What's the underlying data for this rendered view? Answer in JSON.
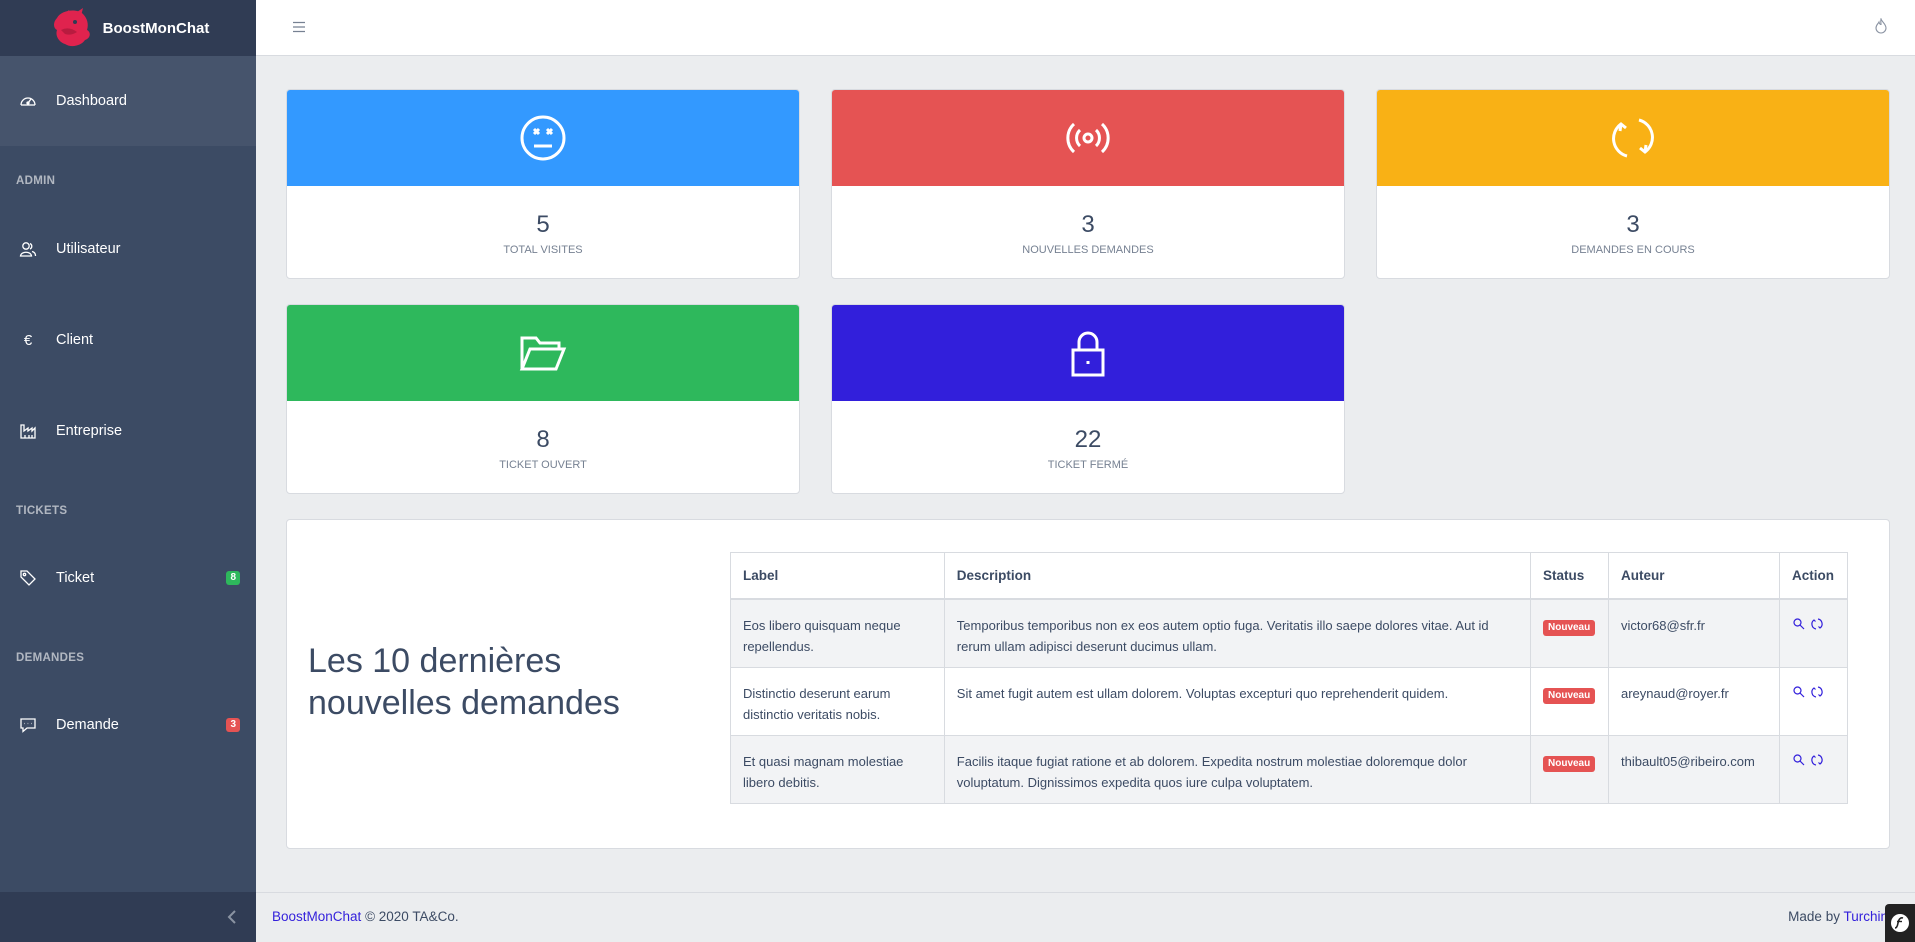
{
  "app": {
    "brand": "BoostMonChat"
  },
  "sidebar": {
    "items": [
      {
        "label": "Dashboard",
        "icon": "speedometer-icon"
      },
      {
        "title": "ADMIN"
      },
      {
        "label": "Utilisateur",
        "icon": "people-icon"
      },
      {
        "label": "Client",
        "icon": "euro-icon"
      },
      {
        "label": "Entreprise",
        "icon": "industry-icon"
      },
      {
        "title": "TICKETS"
      },
      {
        "label": "Ticket",
        "icon": "tags-icon",
        "badge": "8",
        "badge_color": "#2eb85c"
      },
      {
        "title": "DEMANDES"
      },
      {
        "label": "Demande",
        "icon": "comment-icon",
        "badge": "3",
        "badge_color": "#e55353"
      }
    ]
  },
  "widgets": [
    {
      "value": "5",
      "label": "TOTAL VISITES",
      "color": "#3399ff",
      "icon": "face-dead-icon"
    },
    {
      "value": "3",
      "label": "NOUVELLES DEMANDES",
      "color": "#e55353",
      "icon": "broadcast-icon"
    },
    {
      "value": "3",
      "label": "DEMANDES EN COURS",
      "color": "#f9b115",
      "icon": "sync-icon"
    },
    {
      "value": "8",
      "label": "TICKET OUVERT",
      "color": "#2eb85c",
      "icon": "folder-open-icon"
    },
    {
      "value": "22",
      "label": "TICKET FERMÉ",
      "color": "#321fdb",
      "icon": "lock-icon"
    }
  ],
  "requests": {
    "heading": "Les 10 dernières nouvelles demandes",
    "columns": [
      "Label",
      "Description",
      "Status",
      "Auteur",
      "Action"
    ],
    "rows": [
      {
        "label": "Eos libero quisquam neque repellendus.",
        "description": "Temporibus temporibus non ex eos autem optio fuga. Veritatis illo saepe dolores vitae. Aut id rerum ullam adipisci deserunt ducimus ullam.",
        "status": "Nouveau",
        "author": "victor68@sfr.fr"
      },
      {
        "label": "Distinctio deserunt earum distinctio veritatis nobis.",
        "description": "Sit amet fugit autem est ullam dolorem. Voluptas excepturi quo reprehenderit quidem.",
        "status": "Nouveau",
        "author": "areynaud@royer.fr"
      },
      {
        "label": "Et quasi magnam molestiae libero debitis.",
        "description": "Facilis itaque fugiat ratione et ab dolorem. Expedita nostrum molestiae doloremque dolor voluptatum. Dignissimos expedita quos iure culpa voluptatem.",
        "status": "Nouveau",
        "author": "thibault05@ribeiro.com"
      }
    ]
  },
  "footer": {
    "brand_link": "BoostMonChat",
    "copyright": "© 2020 TA&Co.",
    "made_by": "Made by",
    "author_link": "Turchini A"
  }
}
